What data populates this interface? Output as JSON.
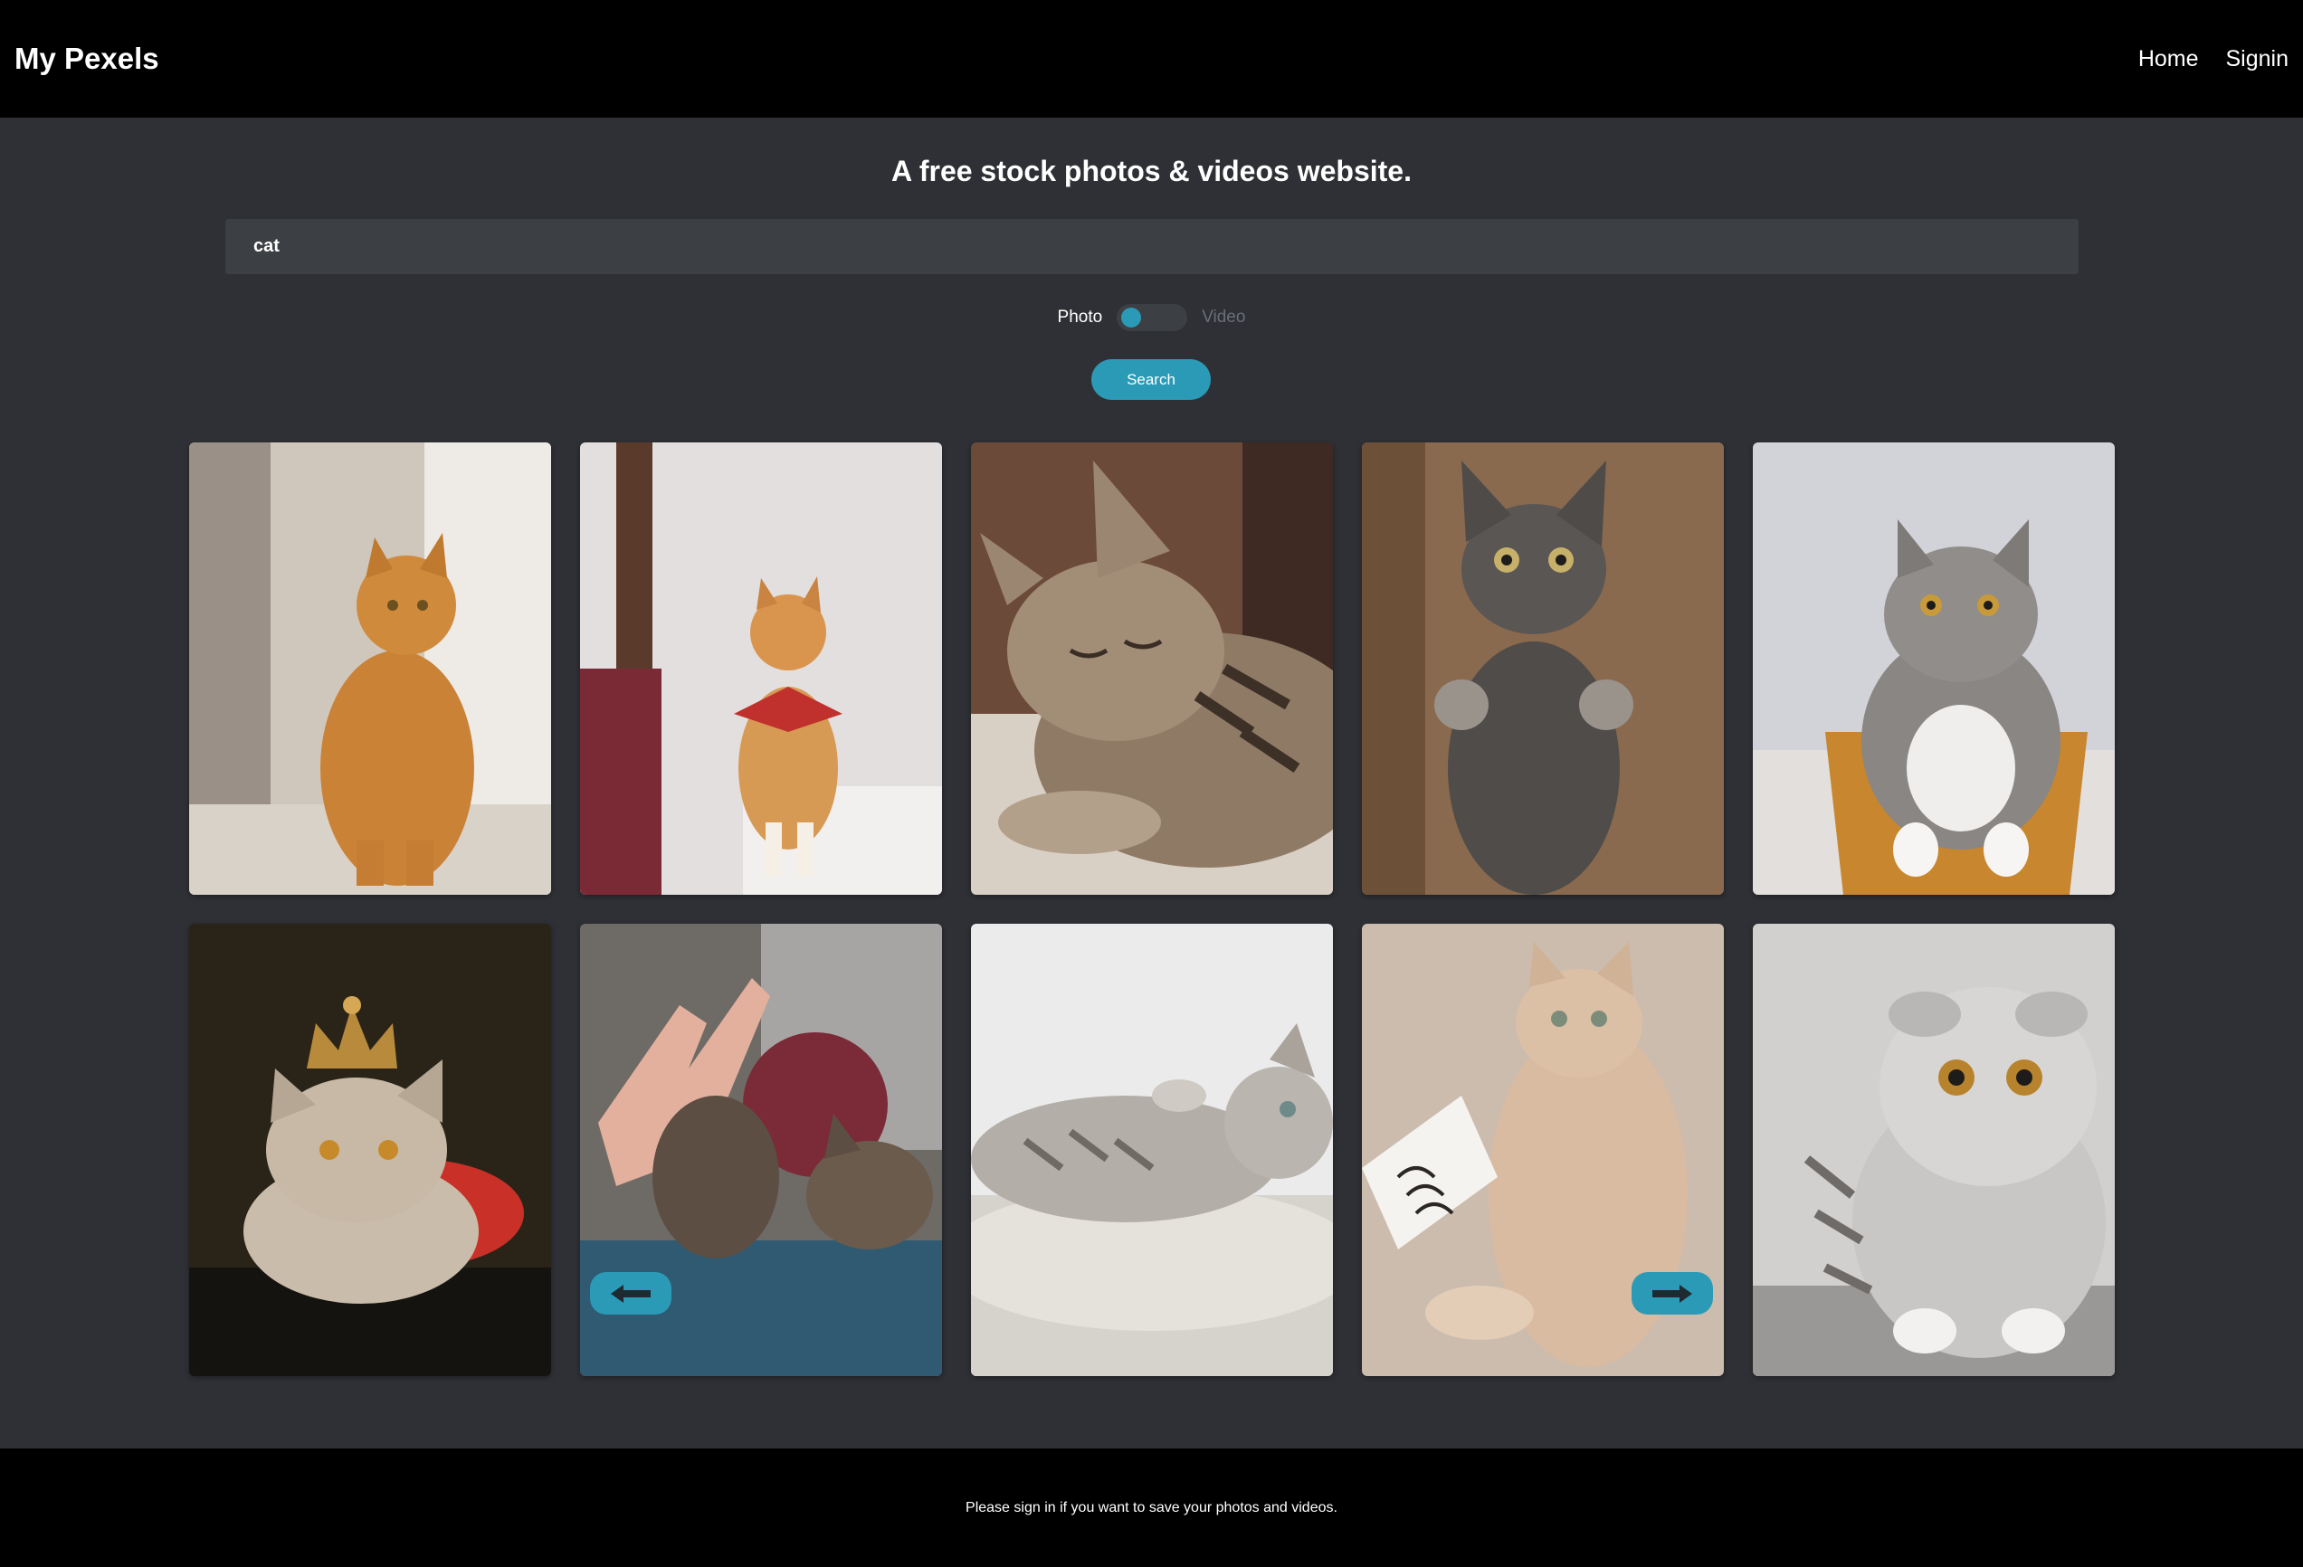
{
  "navbar": {
    "brand": "My Pexels",
    "links": [
      "Home",
      "Signin"
    ]
  },
  "hero": {
    "tagline": "A free stock photos & videos website."
  },
  "search": {
    "value": "cat",
    "button_label": "Search"
  },
  "media_toggle": {
    "left_label": "Photo",
    "right_label": "Video",
    "selected": "Photo"
  },
  "gallery": {
    "photos": [
      {
        "subject": "orange tabby cat sitting by window"
      },
      {
        "subject": "orange cat with red bandana"
      },
      {
        "subject": "sleeping tabby kitten"
      },
      {
        "subject": "grey kitten standing on hind legs"
      },
      {
        "subject": "grey and white cat in wicker basket"
      },
      {
        "subject": "cream cat wearing a crown"
      },
      {
        "subject": "hand giving high five to cat paw"
      },
      {
        "subject": "silver tabby cat lying on rug"
      },
      {
        "subject": "beige cat with handwritten note"
      },
      {
        "subject": "silver scottish fold kitten"
      }
    ]
  },
  "pagination": {
    "prev_icon": "arrow-left-icon",
    "next_icon": "arrow-right-icon"
  },
  "footer": {
    "text": "Please sign in if you want to save your photos and videos."
  },
  "colors": {
    "accent": "#2a9ab7",
    "background": "#2e3035",
    "navbar": "#000000",
    "input": "#3c3f44"
  }
}
